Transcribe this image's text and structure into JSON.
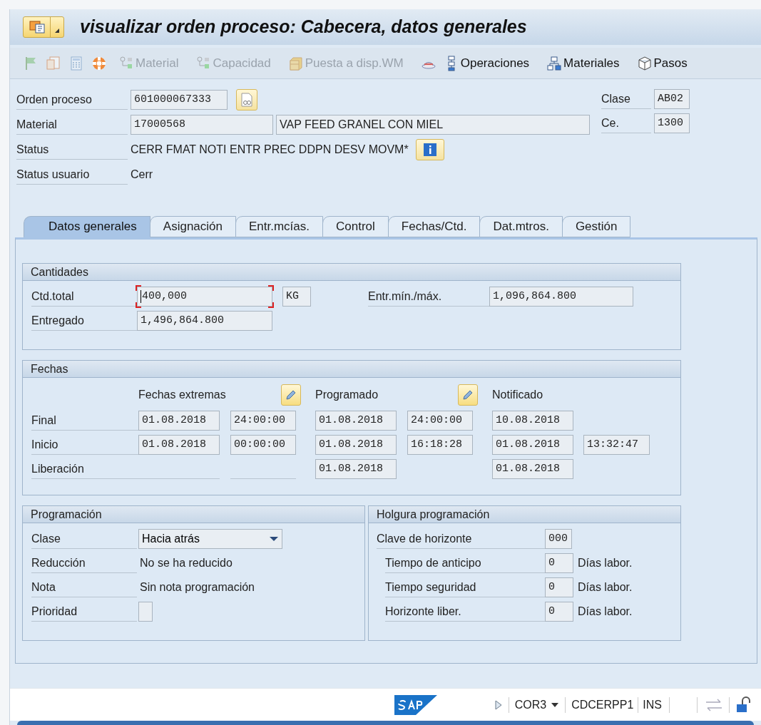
{
  "window": {
    "title": "visualizar orden proceso: Cabecera, datos generales"
  },
  "toolbar": [
    {
      "kind": "flag",
      "disabled": true
    },
    {
      "kind": "document",
      "disabled": true
    },
    {
      "kind": "calculator",
      "disabled": true
    },
    {
      "kind": "lifebuoy",
      "disabled": false
    },
    {
      "kind": "components",
      "label": "Material",
      "disabled": true
    },
    {
      "kind": "components",
      "label": "Capacidad",
      "disabled": true
    },
    {
      "kind": "shelf",
      "label": "Puesta a disp.WM",
      "disabled": true
    },
    {
      "kind": "hat",
      "disabled": false
    },
    {
      "kind": "operations",
      "label": "Operaciones",
      "disabled": false
    },
    {
      "kind": "hierarchy",
      "label": "Materiales",
      "disabled": false
    },
    {
      "kind": "cube",
      "label": "Pasos",
      "disabled": false
    }
  ],
  "header": {
    "orden_proceso": {
      "label": "Orden proceso",
      "value": "601000067333"
    },
    "material": {
      "label": "Material",
      "value": "17000568",
      "description": "VAP FEED GRANEL CON MIEL"
    },
    "status": {
      "label": "Status",
      "value": "CERR FMAT NOTI ENTR PREC DDPN DESV MOVM*"
    },
    "status_usuario": {
      "label": "Status usuario",
      "value": "Cerr"
    },
    "clase": {
      "label": "Clase",
      "value": "AB02"
    },
    "centro": {
      "label": "Ce.",
      "value": "1300"
    }
  },
  "tabs": [
    {
      "label": "Datos generales",
      "selected": true
    },
    {
      "label": "Asignación",
      "selected": false
    },
    {
      "label": "Entr.mcías.",
      "selected": false
    },
    {
      "label": "Control",
      "selected": false
    },
    {
      "label": "Fechas/Ctd.",
      "selected": false
    },
    {
      "label": "Dat.mtros.",
      "selected": false
    },
    {
      "label": "Gestión",
      "selected": false
    }
  ],
  "cantidades": {
    "title": "Cantidades",
    "ctd_total": {
      "label": "Ctd.total",
      "value": "400,000",
      "unit": "KG",
      "focused": true
    },
    "entr_min_max": {
      "label": "Entr.mín./máx.",
      "value": "1,096,864.800"
    },
    "entregado": {
      "label": "Entregado",
      "value": "1,496,864.800",
      "focused": false
    }
  },
  "fechas": {
    "title": "Fechas",
    "columns": [
      {
        "label": "Fechas extremas",
        "edit": true
      },
      {
        "label": "Programado",
        "edit": true
      },
      {
        "label": "Notificado",
        "edit": false
      }
    ],
    "rows": [
      {
        "label": "Final",
        "extremas_fecha": "01.08.2018",
        "extremas_hora": "24:00:00",
        "programado_fecha": "01.08.2018",
        "programado_hora": "24:00:00",
        "notificado_fecha": "10.08.2018"
      },
      {
        "label": "Inicio",
        "extremas_fecha": "01.08.2018",
        "extremas_hora": "00:00:00",
        "programado_fecha": "01.08.2018",
        "programado_hora": "16:18:28",
        "notificado_fecha": "01.08.2018",
        "notificado_hora": "13:32:47"
      },
      {
        "label": "Liberación",
        "programado_fecha": "01.08.2018",
        "notificado_fecha": "01.08.2018"
      }
    ]
  },
  "programacion": {
    "title": "Programación",
    "rows": [
      {
        "kind": "dropdown",
        "label": "Clase",
        "value": "Hacia atrás"
      },
      {
        "kind": "text",
        "label": "Reducción",
        "value": "No se ha reducido"
      },
      {
        "kind": "text",
        "label": "Nota",
        "value": "Sin nota programación"
      },
      {
        "kind": "checkbox",
        "label": "Prioridad",
        "checked": false
      }
    ]
  },
  "holgura": {
    "title": "Holgura programación",
    "clave": {
      "label": "Clave de horizonte",
      "value": "000"
    },
    "rows": [
      {
        "label": "Tiempo de anticipo",
        "value": "0",
        "unit": "Días labor."
      },
      {
        "label": "Tiempo seguridad",
        "value": "0",
        "unit": "Días labor."
      },
      {
        "label": "Horizonte liber.",
        "value": "0",
        "unit": "Días labor."
      }
    ]
  },
  "status_bar": {
    "transaction": "COR3",
    "server": "CDCERPP1",
    "mode": "INS"
  }
}
